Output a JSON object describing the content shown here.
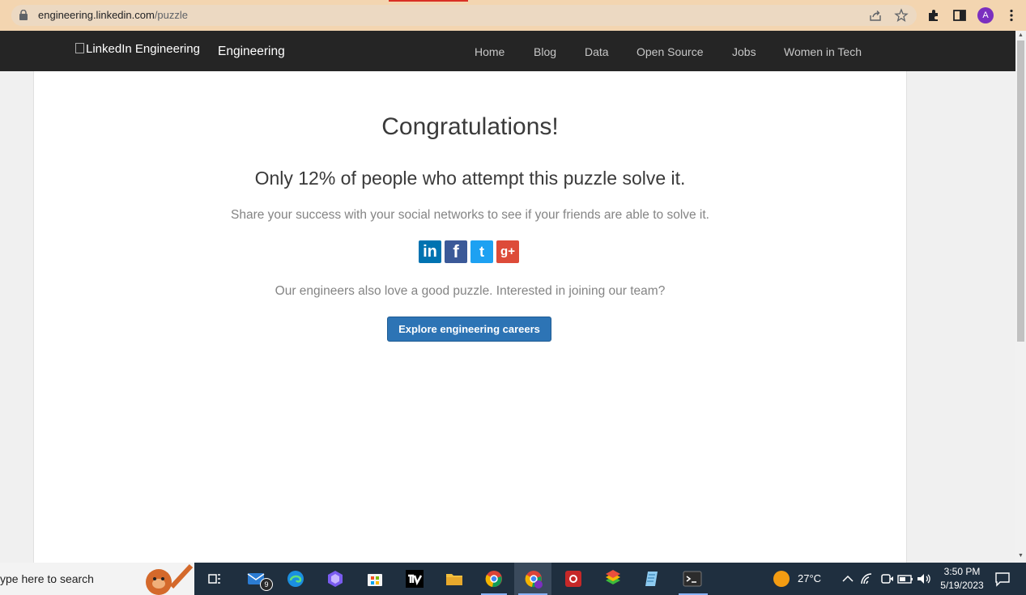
{
  "browser": {
    "url_domain": "engineering.linkedin.com",
    "url_path": "/puzzle",
    "profile_initial": "A",
    "accent_color": "#f3d5b0"
  },
  "site": {
    "logo_alt": "LinkedIn Engineering",
    "title": "Engineering",
    "nav": [
      "Home",
      "Blog",
      "Data",
      "Open Source",
      "Jobs",
      "Women in Tech"
    ]
  },
  "main": {
    "heading": "Congratulations!",
    "stat_text": "Only 12% of people who attempt this puzzle solve it.",
    "share_text": "Share your success with your social networks to see if your friends are able to solve it.",
    "share_buttons": [
      {
        "label": "in",
        "icon": "linkedin-icon",
        "color": "#0073b1"
      },
      {
        "label": "f",
        "icon": "facebook-icon",
        "color": "#3b5998"
      },
      {
        "label": "t",
        "icon": "twitter-icon",
        "color": "#1da1f2"
      },
      {
        "label": "g+",
        "icon": "google-plus-icon",
        "color": "#dd4b39"
      }
    ],
    "join_text": "Our engineers also love a good puzzle. Interested in joining our team?",
    "cta_label": "Explore engineering careers",
    "cta_color": "#2d74b5"
  },
  "taskbar": {
    "search_placeholder": "ype here to search",
    "mail_badge": "9",
    "weather": "27°C",
    "time": "3:50 PM",
    "date": "5/19/2023"
  }
}
